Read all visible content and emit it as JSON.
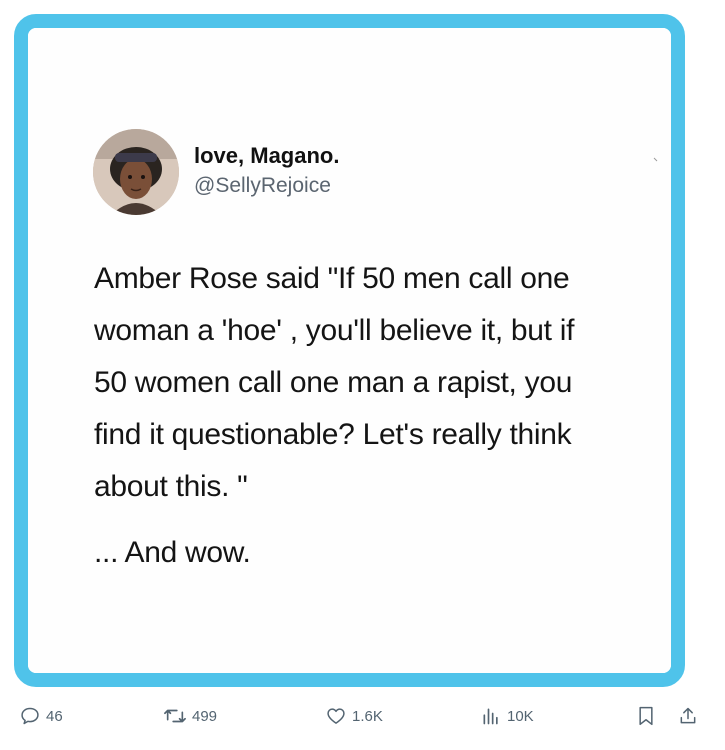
{
  "tweet": {
    "author_name": "love, Magano.",
    "author_handle": "@SellyRejoice",
    "body_lines": [
      "Amber Rose said  \"If 50 men call one",
      "woman a 'hoe' , you'll believe it, but if",
      "50 women call one man a rapist, you",
      "find it questionable? Let's really think",
      "about this. \""
    ],
    "tail": "... And wow."
  },
  "actions": {
    "replies": "46",
    "retweets": "499",
    "likes": "1.6K",
    "views": "10K"
  },
  "icons": {
    "reply": "reply-icon",
    "retweet": "retweet-icon",
    "like": "heart-icon",
    "views": "views-icon",
    "bookmark": "bookmark-icon",
    "share": "share-icon"
  },
  "colors": {
    "frame": "#4fc3ea",
    "icon": "#536471"
  }
}
